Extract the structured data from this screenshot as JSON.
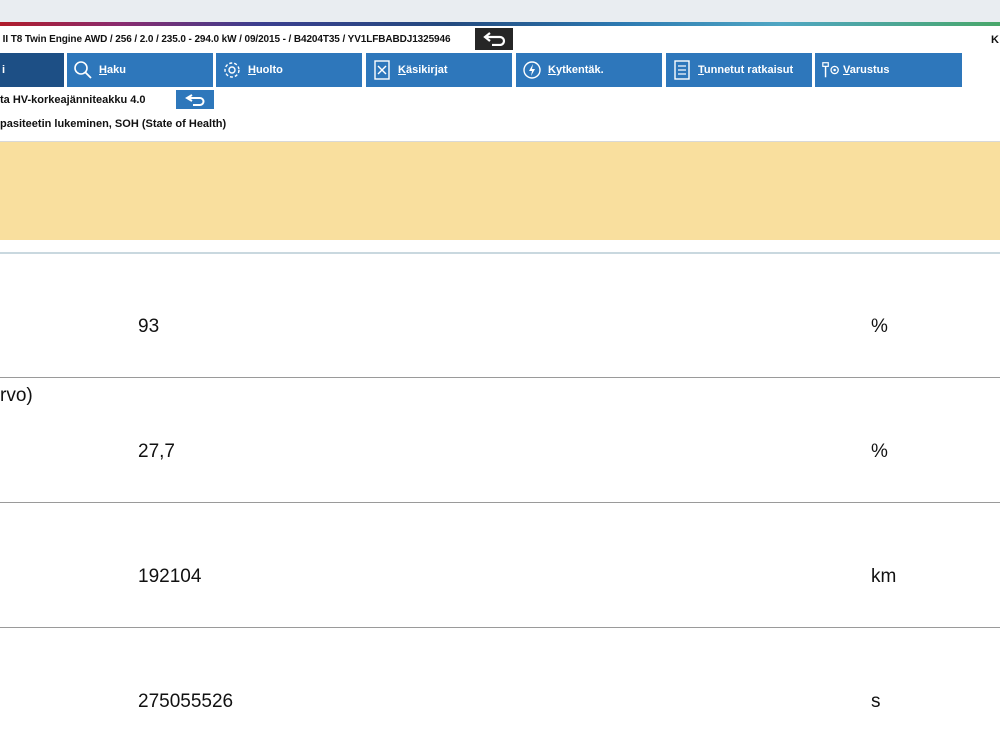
{
  "header": {
    "vehicle_info": "­ II T8 Twin Engine AWD / 256 / 2.0 / 235.0 - 294.0 kW / 09/2015 - / B4204T35 / YV1LFBABDJ1325946",
    "right_letter": "K"
  },
  "tabs": [
    {
      "label": "i",
      "icon": "home-icon",
      "active": true
    },
    {
      "label": "Haku",
      "icon": "search-icon"
    },
    {
      "label": "Huolto",
      "icon": "gear-icon"
    },
    {
      "label": "Käsikirjat",
      "icon": "manual-icon"
    },
    {
      "label": "Kytkentäk.",
      "icon": "lightning-icon"
    },
    {
      "label": "Tunnetut ratkaisut",
      "icon": "document-list-icon"
    },
    {
      "label": "Varustus",
      "icon": "equipment-icon"
    }
  ],
  "breadcrumb": {
    "title": "ta HV-korkeajänniteakku 4.0",
    "subtitle": "pasiteetin lukeminen, SOH (State of Health)"
  },
  "readings": [
    {
      "label": "",
      "value": "93",
      "unit": "%"
    },
    {
      "label": "rvo)",
      "value": "27,7",
      "unit": "%"
    },
    {
      "label": "",
      "value": "192104",
      "unit": "km"
    },
    {
      "label": "",
      "value": "275055526",
      "unit": "s"
    }
  ],
  "colors": {
    "tab_blue": "#2e77bb",
    "tab_active": "#1d4f85",
    "banner_yellow": "#f9df9e"
  }
}
